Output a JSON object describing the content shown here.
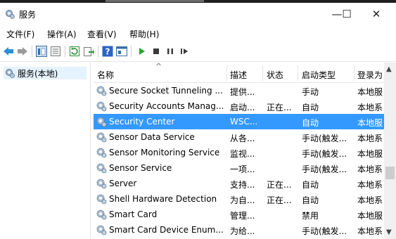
{
  "window": {
    "title": "服务",
    "minimize_glyph": "—",
    "maximize_glyph": "☐",
    "close_glyph": "✕"
  },
  "menu": [
    "文件(F)",
    "操作(A)",
    "查看(V)",
    "帮助(H)"
  ],
  "toolbar_icons": [
    "back-arrow-icon",
    "forward-arrow-icon",
    "show-hide-tree-icon",
    "properties-icon",
    "refresh-icon",
    "export-list-icon",
    "help-icon",
    "console-view-icon",
    "start-service-icon",
    "stop-service-icon",
    "pause-service-icon",
    "resume-service-icon"
  ],
  "tree": {
    "selected": "服务(本地)"
  },
  "list": {
    "columns": [
      "名称",
      "描述",
      "状态",
      "启动类型",
      "登录为"
    ],
    "rows": [
      {
        "name": "Secure Socket Tunneling ...",
        "desc": "提供...",
        "status": "",
        "startup": "手动",
        "logon": "本地服"
      },
      {
        "name": "Security Accounts Manag...",
        "desc": "启动...",
        "status": "正在...",
        "startup": "自动",
        "logon": "本地系"
      },
      {
        "name": "Security Center",
        "desc": "WSC...",
        "status": "",
        "startup": "自动",
        "logon": "本地服",
        "selected": true
      },
      {
        "name": "Sensor Data Service",
        "desc": "从各...",
        "status": "",
        "startup": "手动(触发...",
        "logon": "本地系"
      },
      {
        "name": "Sensor Monitoring Service",
        "desc": "监视...",
        "status": "",
        "startup": "手动(触发...",
        "logon": "本地服"
      },
      {
        "name": "Sensor Service",
        "desc": "一项...",
        "status": "",
        "startup": "手动(触发...",
        "logon": "本地系"
      },
      {
        "name": "Server",
        "desc": "支持...",
        "status": "正在...",
        "startup": "自动",
        "logon": "本地系"
      },
      {
        "name": "Shell Hardware Detection",
        "desc": "为自...",
        "status": "正在...",
        "startup": "自动",
        "logon": "本地系"
      },
      {
        "name": "Smart Card",
        "desc": "管理...",
        "status": "",
        "startup": "禁用",
        "logon": "本地服"
      },
      {
        "name": "Smart Card Device Enum...",
        "desc": "为给...",
        "status": "",
        "startup": "手动(触发...",
        "logon": "本地系"
      }
    ]
  },
  "colors": {
    "selection": "#3399ff",
    "tree_selection": "#e5f3ff"
  }
}
